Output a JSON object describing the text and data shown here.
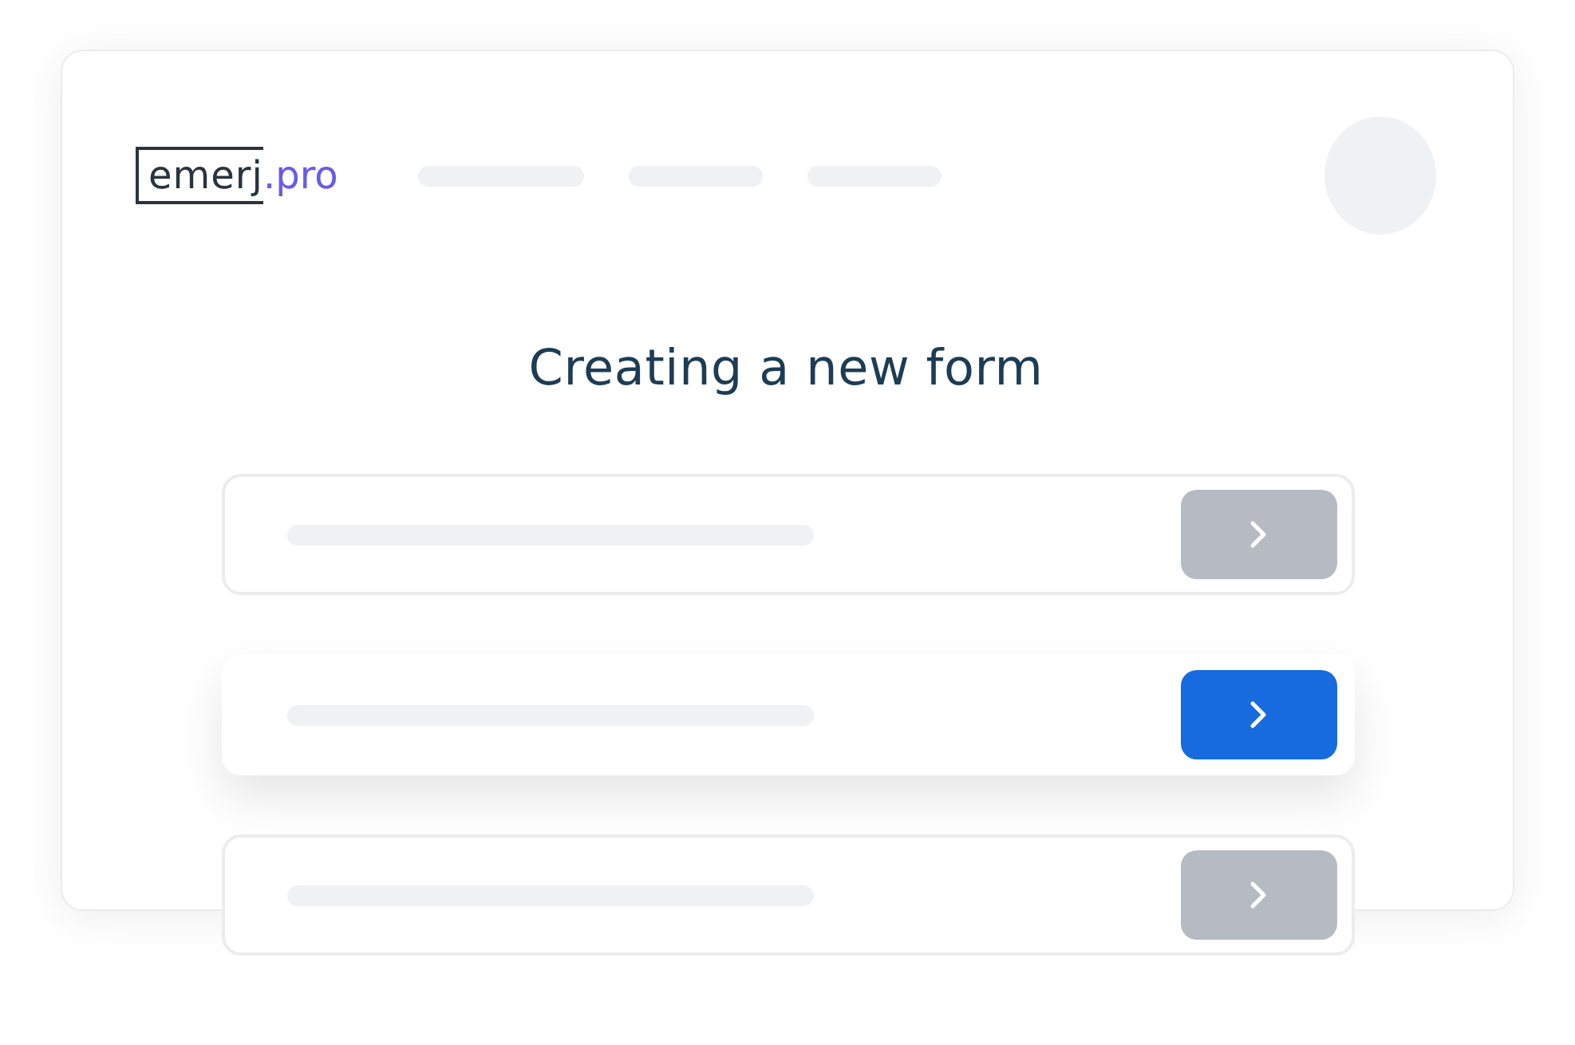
{
  "logo": {
    "name": "emerj",
    "suffix": ".pro"
  },
  "title": "Creating a new form",
  "rows": [
    {
      "selected": false
    },
    {
      "selected": true
    },
    {
      "selected": false
    }
  ]
}
